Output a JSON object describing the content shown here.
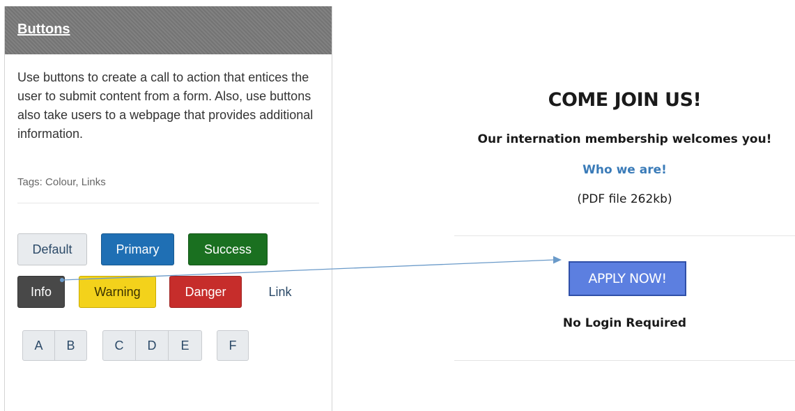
{
  "card": {
    "title": "Buttons",
    "description": "Use buttons to create a call to action that entices the user to submit content from a form. Also, use buttons also take users to a webpage that provides additional information.",
    "tags": "Tags: Colour, Links"
  },
  "buttons": {
    "default": "Default",
    "primary": "Primary",
    "success": "Success",
    "info": "Info",
    "warning": "Warning",
    "danger": "Danger",
    "link": "Link"
  },
  "button_groups": {
    "a": "A",
    "b": "B",
    "c": "C",
    "d": "D",
    "e": "E",
    "f": "F"
  },
  "panel": {
    "title": "COME JOIN US!",
    "subtitle": "Our internation membership welcomes you!",
    "link": "Who we are!",
    "note": "(PDF file 262kb)",
    "apply": "APPLY NOW!",
    "login_note": "No Login Required"
  },
  "colors": {
    "header": "#7a7a7a",
    "primary": "#1f6fb4",
    "success": "#1a7020",
    "info": "#484848",
    "warning": "#f3d21b",
    "danger": "#c62d2b",
    "apply": "#5c7fe0",
    "link": "#3a7bb8",
    "arrow": "#6a9ac9"
  }
}
